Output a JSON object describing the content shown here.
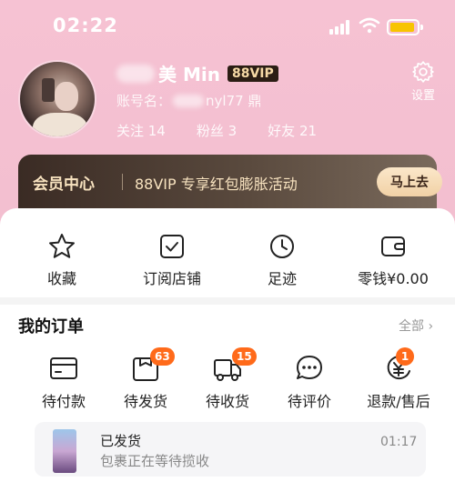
{
  "status_bar": {
    "time": "02:22"
  },
  "profile": {
    "name_suffix": "美 Min",
    "vip": "88VIP",
    "account_label": "账号名：",
    "account_suffix": "nyl77 鼎",
    "stats": [
      {
        "label": "关注 14"
      },
      {
        "label": "粉丝 3"
      },
      {
        "label": "好友 21"
      }
    ],
    "settings_label": "设置"
  },
  "banner": {
    "title": "会员中心",
    "text": "88VIP 专享红包膨胀活动",
    "button": "马上去"
  },
  "quick_links": [
    {
      "label": "收藏",
      "icon": "star-icon"
    },
    {
      "label": "订阅店铺",
      "icon": "check-square-icon"
    },
    {
      "label": "足迹",
      "icon": "clock-icon"
    },
    {
      "label": "零钱¥0.00",
      "icon": "wallet-icon"
    }
  ],
  "orders": {
    "title": "我的订单",
    "all_label": "全部 ›",
    "items": [
      {
        "label": "待付款",
        "icon": "card-icon",
        "badge": ""
      },
      {
        "label": "待发货",
        "icon": "package-icon",
        "badge": "63"
      },
      {
        "label": "待收货",
        "icon": "truck-icon",
        "badge": "15"
      },
      {
        "label": "待评价",
        "icon": "comment-icon",
        "badge": ""
      },
      {
        "label": "退款/售后",
        "icon": "refund-icon",
        "badge": "1"
      }
    ]
  },
  "shipping": {
    "title": "已发货",
    "subtitle": "包裹正在等待揽收",
    "time": "01:17"
  },
  "colors": {
    "accent": "#ff6a1a",
    "pink_bg": "#f3bfd0",
    "vip_gold": "#f7e2bf"
  }
}
